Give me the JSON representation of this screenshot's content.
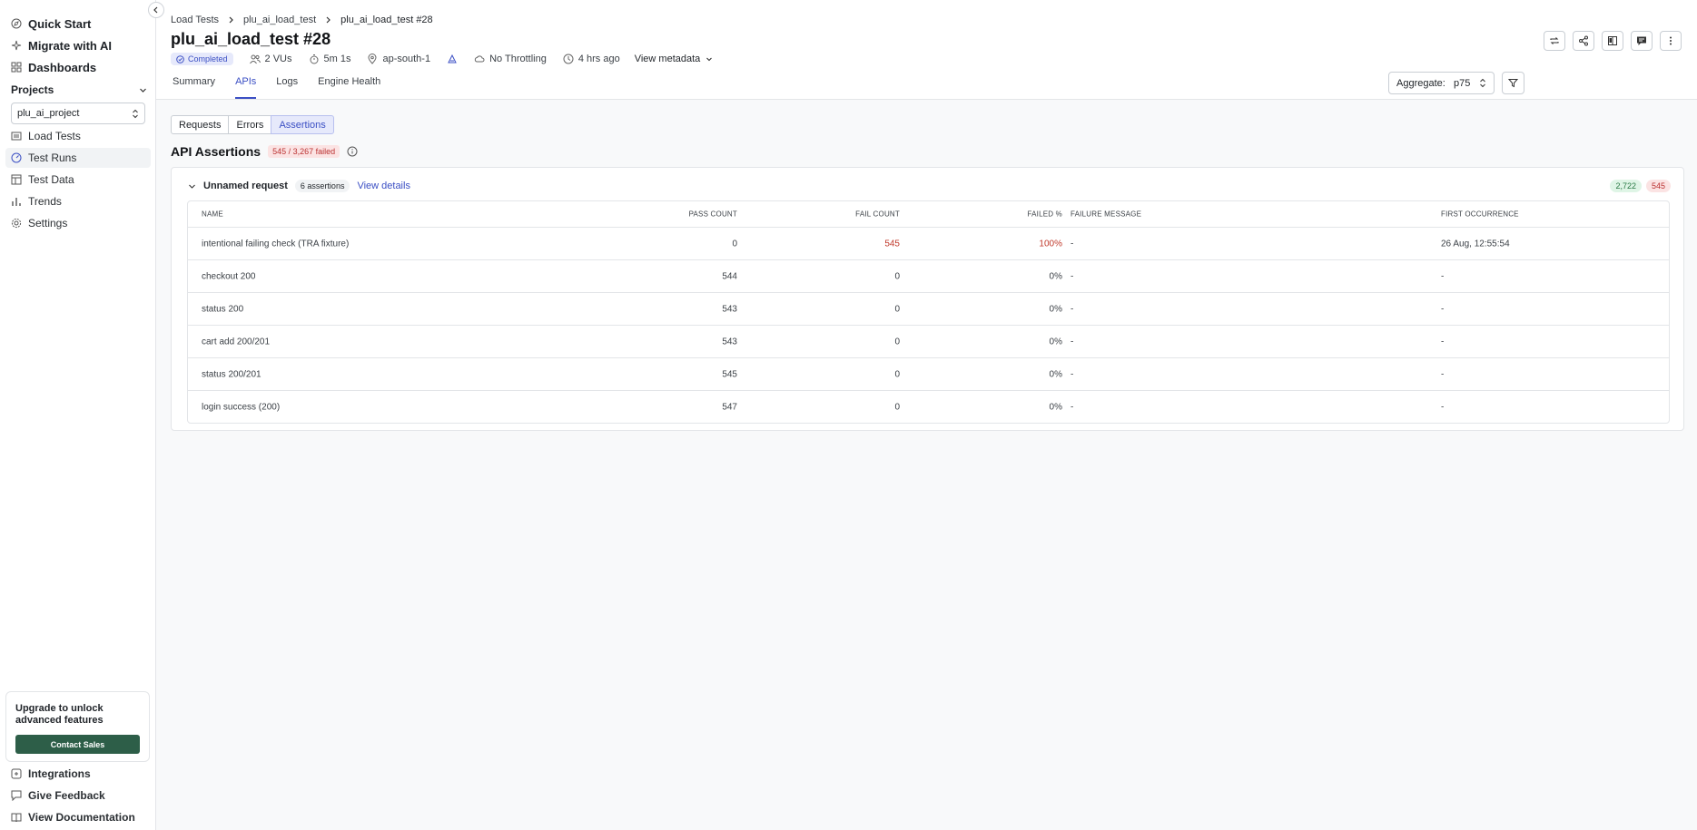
{
  "sidebar": {
    "top_items": [
      {
        "label": "Quick Start",
        "icon": "compass-icon"
      },
      {
        "label": "Migrate with AI",
        "icon": "sparkle-icon"
      },
      {
        "label": "Dashboards",
        "icon": "grid-icon"
      }
    ],
    "projects_label": "Projects",
    "project_selected": "plu_ai_project",
    "project_items": [
      {
        "label": "Load Tests",
        "icon": "list-icon"
      },
      {
        "label": "Test Runs",
        "icon": "gauge-icon",
        "active": true
      },
      {
        "label": "Test Data",
        "icon": "table-icon"
      },
      {
        "label": "Trends",
        "icon": "bar-chart-icon"
      },
      {
        "label": "Settings",
        "icon": "gear-icon"
      }
    ],
    "upgrade_text": "Upgrade to unlock advanced features",
    "contact_sales": "Contact Sales",
    "bottom_items": [
      {
        "label": "Integrations",
        "icon": "plug-icon"
      },
      {
        "label": "Give Feedback",
        "icon": "message-icon"
      },
      {
        "label": "View Documentation",
        "icon": "book-icon"
      }
    ]
  },
  "header": {
    "breadcrumb": [
      "Load Tests",
      "plu_ai_load_test",
      "plu_ai_load_test #28"
    ],
    "title": "plu_ai_load_test #28",
    "status": "Completed",
    "vus": "2 VUs",
    "duration": "5m 1s",
    "region": "ap-south-1",
    "throttling": "No Throttling",
    "time_ago": "4 hrs ago",
    "view_metadata": "View metadata",
    "tabs": [
      "Summary",
      "APIs",
      "Logs",
      "Engine Health"
    ],
    "active_tab": "APIs",
    "aggregate_label": "Aggregate:",
    "aggregate_value": "p75"
  },
  "main": {
    "segments": [
      "Requests",
      "Errors",
      "Assertions"
    ],
    "active_segment": "Assertions",
    "section_title": "API Assertions",
    "failed_badge": "545 / 3,267 failed",
    "request": {
      "name": "Unnamed request",
      "assertions_count": "6 assertions",
      "view_details": "View details",
      "pass_total": "2,722",
      "fail_total": "545"
    },
    "columns": [
      "NAME",
      "PASS COUNT",
      "FAIL COUNT",
      "FAILED %",
      "FAILURE MESSAGE",
      "FIRST OCCURRENCE"
    ],
    "rows": [
      {
        "name": "intentional failing check (TRA fixture)",
        "pass": "0",
        "fail": "545",
        "pct": "100%",
        "msg": "-",
        "first": "26 Aug, 12:55:54"
      },
      {
        "name": "checkout 200",
        "pass": "544",
        "fail": "0",
        "pct": "0%",
        "msg": "-",
        "first": "-"
      },
      {
        "name": "status 200",
        "pass": "543",
        "fail": "0",
        "pct": "0%",
        "msg": "-",
        "first": "-"
      },
      {
        "name": "cart add 200/201",
        "pass": "543",
        "fail": "0",
        "pct": "0%",
        "msg": "-",
        "first": "-"
      },
      {
        "name": "status 200/201",
        "pass": "545",
        "fail": "0",
        "pct": "0%",
        "msg": "-",
        "first": "-"
      },
      {
        "name": "login success (200)",
        "pass": "547",
        "fail": "0",
        "pct": "0%",
        "msg": "-",
        "first": "-"
      }
    ]
  },
  "colors": {
    "accent": "#3b4fc4",
    "danger": "#c0392b",
    "success": "#2a7a45",
    "sales_button": "#2d5e48"
  }
}
